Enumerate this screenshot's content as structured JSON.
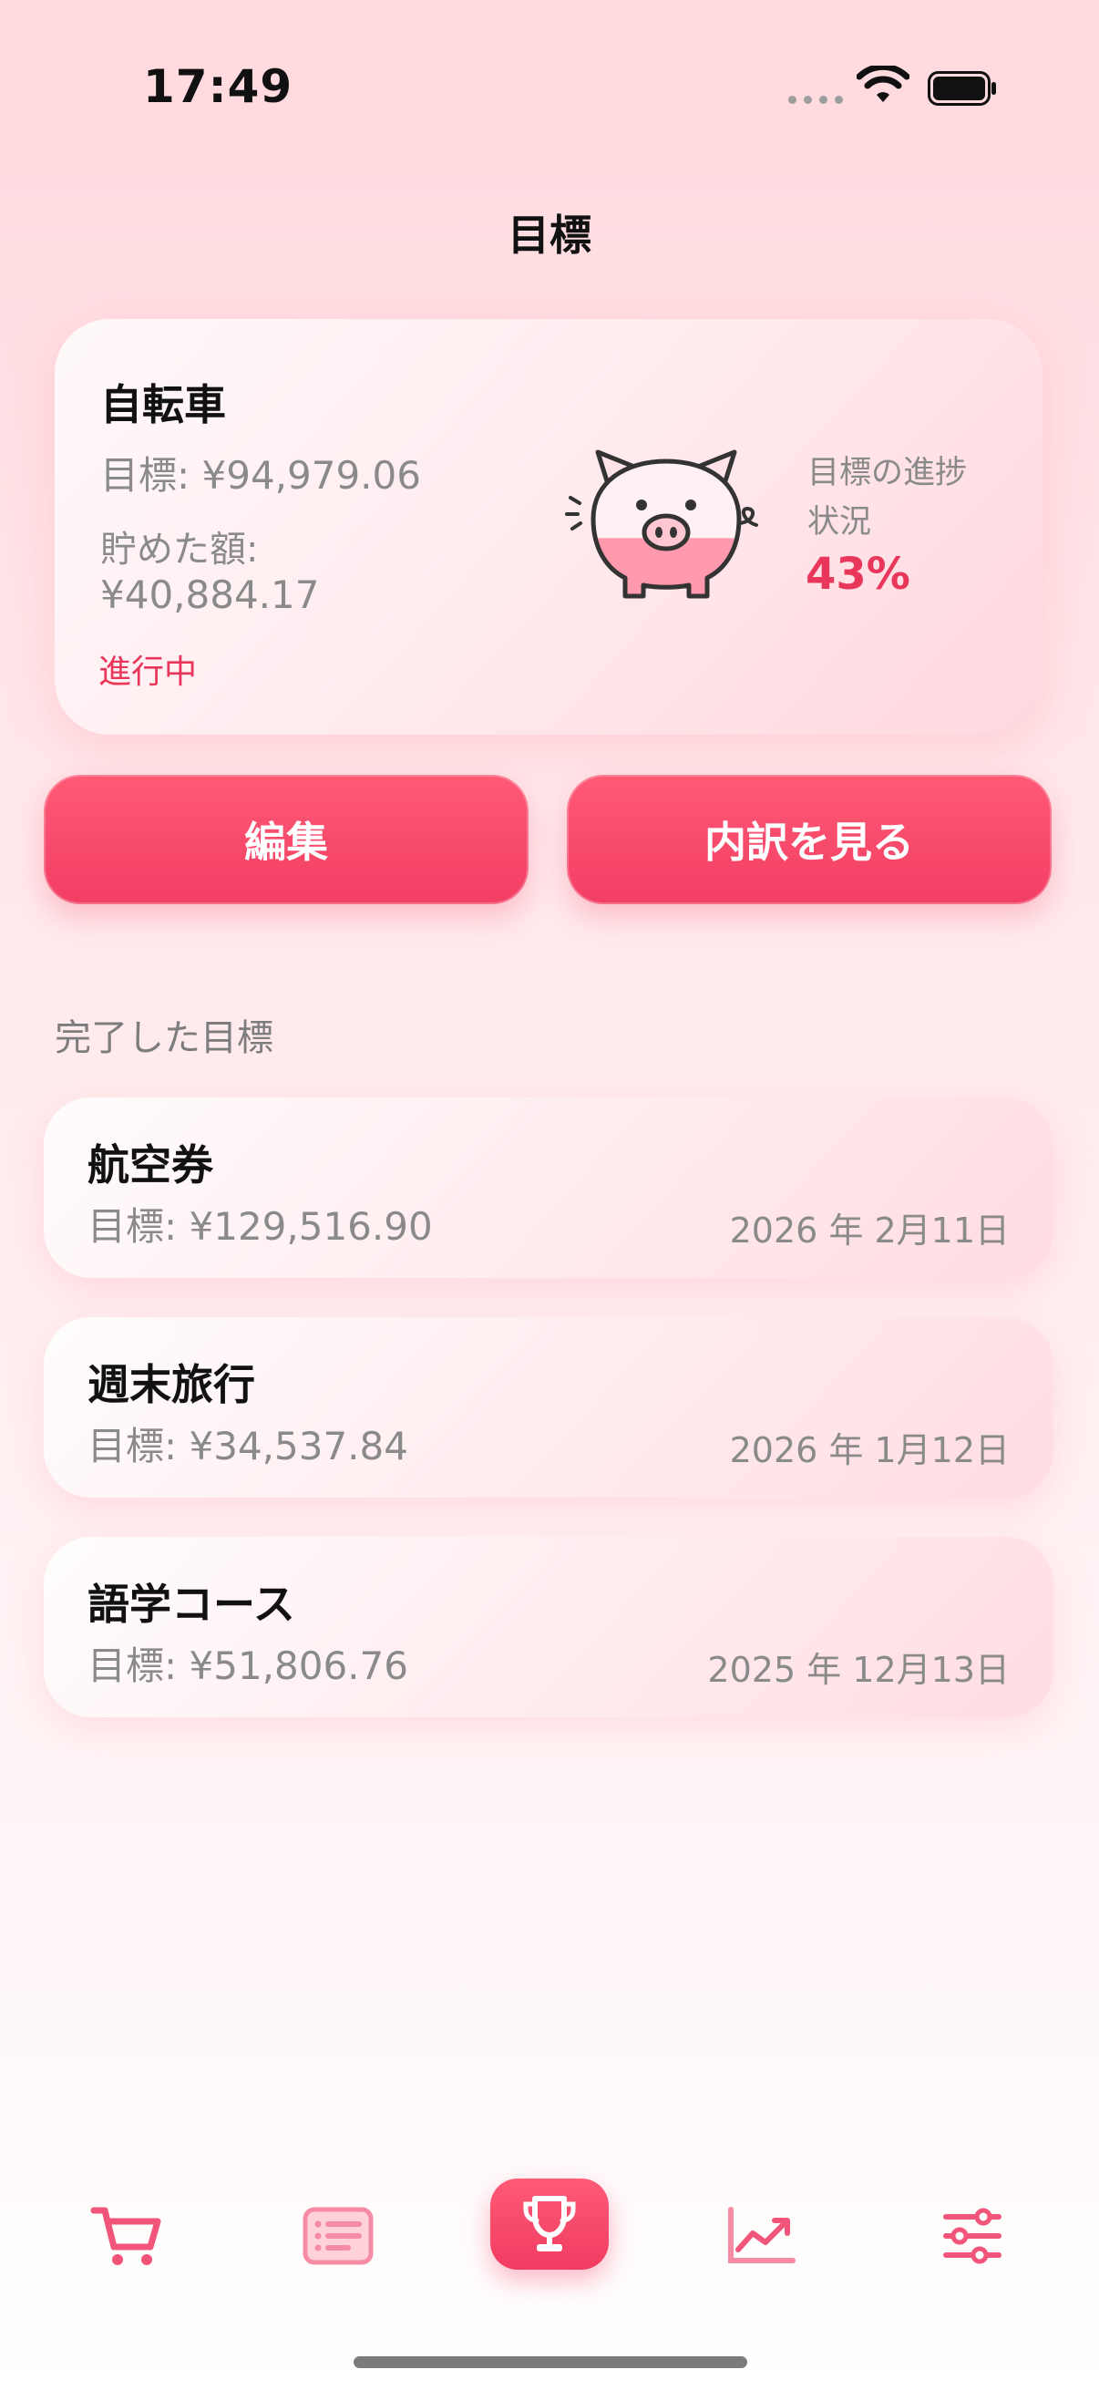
{
  "status_bar": {
    "time": "17:49"
  },
  "header": {
    "title": "目標"
  },
  "current_goal": {
    "name": "自転車",
    "target": "目標: ¥94,979.06",
    "saved_label": "貯めた額:",
    "saved_value": "¥40,884.17",
    "status": "進行中",
    "progress_label": "目標の進捗状況",
    "progress_value": "43%",
    "progress_fraction": 0.43
  },
  "actions": {
    "edit_label": "編集",
    "detail_label": "内訳を見る"
  },
  "completed": {
    "section_title": "完了した目標",
    "items": [
      {
        "name": "航空券",
        "target": "目標: ¥129,516.90",
        "date": "2026 年 2月11日"
      },
      {
        "name": "週末旅行",
        "target": "目標: ¥34,537.84",
        "date": "2026 年 1月12日"
      },
      {
        "name": "語学コース",
        "target": "目標: ¥51,806.76",
        "date": "2025 年 12月13日"
      }
    ]
  },
  "tab_bar": {
    "items": [
      {
        "icon": "cart-icon"
      },
      {
        "icon": "list-icon"
      },
      {
        "icon": "trophy-icon",
        "active": true
      },
      {
        "icon": "chart-trend-icon"
      },
      {
        "icon": "sliders-icon"
      }
    ]
  },
  "colors": {
    "accent": "#F23E63",
    "muted_text": "#8A8A8A",
    "status": "#E8375A"
  }
}
